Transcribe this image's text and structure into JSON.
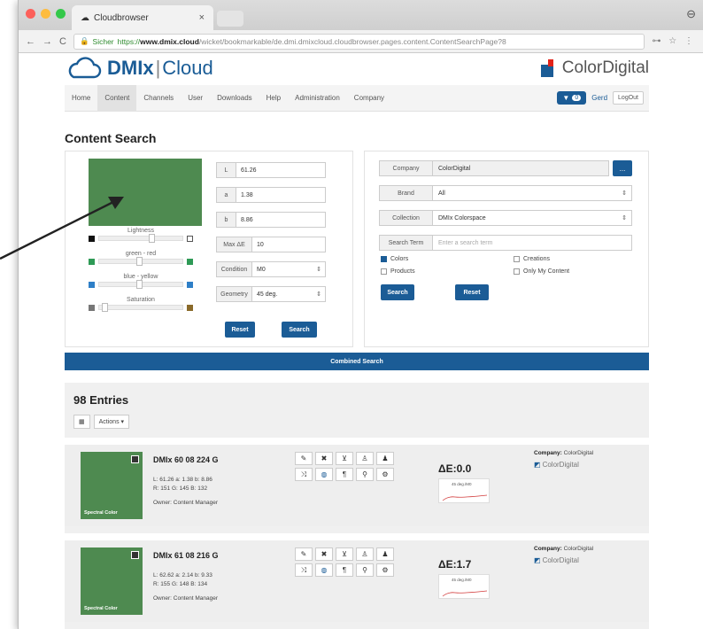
{
  "browser": {
    "tab_title": "Cloudbrowser",
    "tab_close": "×",
    "window_icon": "⊖",
    "nav_back": "←",
    "nav_forward": "→",
    "nav_reload": "C",
    "secure_label": "Sicher",
    "url_scheme": "https://",
    "url_host": "www.dmix.cloud",
    "url_path": "/wicket/bookmarkable/de.dmi.dmixcloud.cloudbrowser.pages.content.ContentSearchPage?8",
    "addr_right": "⊶ ☆ ⋮"
  },
  "header": {
    "logo_dm": "DMIx",
    "logo_sep": "|",
    "logo_cloud": "Cloud",
    "brand": "ColorDigital",
    "nav": [
      "Home",
      "Content",
      "Channels",
      "User",
      "Downloads",
      "Help",
      "Administration",
      "Company"
    ],
    "filter_count": "0",
    "user": "Gerd",
    "logout": "LogOut"
  },
  "content_search": {
    "title": "Content Search",
    "swatch_color": "#4e8a50",
    "sliders": [
      {
        "label": "Lightness",
        "left": "#111111",
        "right": "#ffffff",
        "value": 0.6
      },
      {
        "label": "green - red",
        "left": "#2e9a56",
        "right": "#2e9a56",
        "value": 0.45
      },
      {
        "label": "blue - yellow",
        "left": "#2e7fc7",
        "right": "#2e7fc7",
        "value": 0.45
      },
      {
        "label": "Saturation",
        "left": "#777777",
        "right": "#8a6a2a",
        "value": 0.05
      }
    ],
    "fields": [
      {
        "label": "L",
        "value": "61.26"
      },
      {
        "label": "a",
        "value": "1.38"
      },
      {
        "label": "b",
        "value": "8.86"
      },
      {
        "label": "Max ΔE",
        "value": "10"
      }
    ],
    "condition_label": "Condition",
    "condition_value": "M0",
    "geometry_label": "Geometry",
    "geometry_value": "45 deg.",
    "reset": "Reset",
    "search": "Search"
  },
  "filter_panel": {
    "company_label": "Company",
    "company_value": "ColorDigital",
    "dots": "...",
    "brand_label": "Brand",
    "brand_value": "All",
    "collection_label": "Collection",
    "collection_value": "DMIx Colorspace",
    "search_term_label": "Search Term",
    "search_term_placeholder": "Enter a search term",
    "checkboxes": [
      {
        "label": "Colors",
        "checked": true
      },
      {
        "label": "Creations",
        "checked": false
      },
      {
        "label": "Products",
        "checked": false
      },
      {
        "label": "Only My Content",
        "checked": false
      }
    ],
    "search": "Search",
    "reset": "Reset"
  },
  "combined_search": "Combined Search",
  "results": {
    "count_label": "98 Entries",
    "actions": "Actions ▾",
    "items": [
      {
        "name": "DMIx 60 08 224 G",
        "lab": "L: 61.26 a: 1.38 b: 8.86",
        "rgb": "R: 151 G: 145 B: 132",
        "owner": "Owner: Content Manager",
        "spectral": "Spectral Color",
        "delta": "ΔE:0.0",
        "spark_label": "45 deg./M0",
        "company_label": "Company:",
        "company": "ColorDigital",
        "brand": "ColorDigital",
        "color": "#4e8a50"
      },
      {
        "name": "DMIx 61 08 216 G",
        "lab": "L: 62.62 a: 2.14 b: 9.33",
        "rgb": "R: 155 G: 148 B: 134",
        "owner": "Owner: Content Manager",
        "spectral": "Spectral Color",
        "delta": "ΔE:1.7",
        "spark_label": "45 deg./M0",
        "company_label": "Company:",
        "company": "ColorDigital",
        "brand": "ColorDigital",
        "color": "#4e8a50"
      }
    ]
  },
  "colors": {
    "primary": "#1b5c96",
    "swatch": "#4e8a50"
  }
}
